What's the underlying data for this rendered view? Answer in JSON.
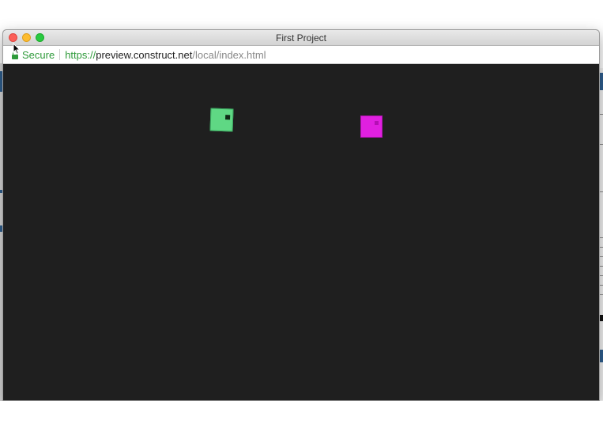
{
  "window": {
    "title": "First Project"
  },
  "address_bar": {
    "security_label": "Secure",
    "url_scheme": "https://",
    "url_host": "preview.construct.net",
    "url_path": "/local/index.html",
    "icon": "lock-icon"
  },
  "traffic_lights": {
    "close": "#fc5f57",
    "minimize": "#fdbc2e",
    "maximize": "#29c940"
  },
  "game": {
    "background_color": "#1f1f1f",
    "sprites": [
      {
        "name": "green-sprite",
        "color": "#5fd884"
      },
      {
        "name": "magenta-sprite",
        "color": "#e020e0"
      }
    ]
  },
  "colors": {
    "secure_green": "#2e9a3a"
  }
}
